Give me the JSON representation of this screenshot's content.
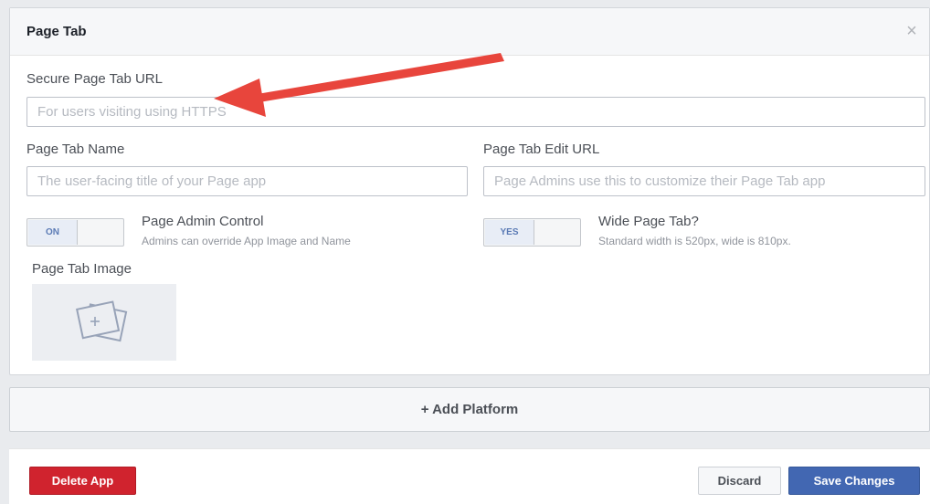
{
  "panel": {
    "title": "Page Tab",
    "close_glyph": "×"
  },
  "secure_url": {
    "label": "Secure Page Tab URL",
    "placeholder": "For users visiting using HTTPS"
  },
  "tab_name": {
    "label": "Page Tab Name",
    "placeholder": "The user-facing title of your Page app"
  },
  "edit_url": {
    "label": "Page Tab Edit URL",
    "placeholder": "Page Admins use this to customize their Page Tab app"
  },
  "admin_control": {
    "state": "ON",
    "title": "Page Admin Control",
    "description": "Admins can override App Image and Name"
  },
  "wide_tab": {
    "state": "YES",
    "title": "Wide Page Tab?",
    "description": "Standard width is 520px, wide is 810px."
  },
  "tab_image": {
    "label": "Page Tab Image",
    "icon": "add-image-icon"
  },
  "platform": {
    "label": "+ Add Platform"
  },
  "footer": {
    "delete_label": "Delete App",
    "discard_label": "Discard",
    "save_label": "Save Changes"
  },
  "colors": {
    "accent": "#4267b2",
    "danger": "#d0232e",
    "annotation_arrow": "#e8453c"
  }
}
